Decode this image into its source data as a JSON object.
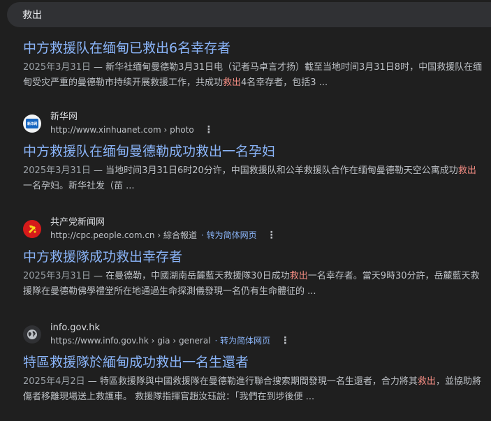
{
  "search": {
    "query": "救出"
  },
  "results": [
    {
      "title": "中方救援队在缅甸已救出6名幸存者",
      "date": "2025年3月31日",
      "dash": " — ",
      "snippet_a": "新华社缅甸曼德勒3月31日电（记者马卓言才扬）截至当地时间3月31日8时，中国救援队在缅甸受灾严重的曼德勒市持续开展救援工作，共成功",
      "snippet_hl": "救出",
      "snippet_b": "4名幸存者，包括3 ..."
    },
    {
      "site_name": "新华网",
      "logo_text": "新华网",
      "url": "http://www.xinhuanet.com › photo",
      "title": "中方救援队在缅甸曼德勒成功救出一名孕妇",
      "date": "2025年3月31日",
      "dash": " — ",
      "snippet_a": "当地时间3月31日6时20分许，中国救援队和公羊救援队合作在缅甸曼德勒天空公寓成功",
      "snippet_hl": "救出",
      "snippet_b": "一名孕妇。新华社发（苗 ..."
    },
    {
      "site_name": "共产党新闻网",
      "url": "http://cpc.people.com.cn › 綜合報道",
      "translate": "· 转为简体网页",
      "title": "中方救援隊成功救出幸存者",
      "date": "2025年3月31日",
      "dash": " — ",
      "snippet_a": "在曼德勒，中國湖南岳麓藍天救援隊30日成功",
      "snippet_hl": "救出",
      "snippet_b": "一名幸存者。當天9時30分許，岳麓藍天救援隊在曼德勒佛學禮堂所在地通過生命探測儀發現一名仍有生命體征的 ..."
    },
    {
      "site_name": "info.gov.hk",
      "url": "https://www.info.gov.hk › gia › general",
      "translate": "· 转为简体网页",
      "title": "特區救援隊於緬甸成功救出一名生還者",
      "date": "2025年4月2日",
      "dash": " — ",
      "snippet_a": "特區救援隊與中國救援隊在曼德勒進行聯合搜索期間發現一名生還者，合力將其",
      "snippet_hl": "救出",
      "snippet_b": "，並協助將傷者移離現場送上救護車。 救援隊指揮官趙汝珏說：「我們在到埗後便 ..."
    }
  ],
  "colors": {
    "link": "#8ab4f8",
    "highlight": "#f28b82",
    "background": "#1f1f1f"
  },
  "icons": {
    "kebab": "⋮",
    "xinhua": "xinhua-logo-icon",
    "cpc": "cpc-emblem-icon",
    "gov": "globe-icon"
  }
}
